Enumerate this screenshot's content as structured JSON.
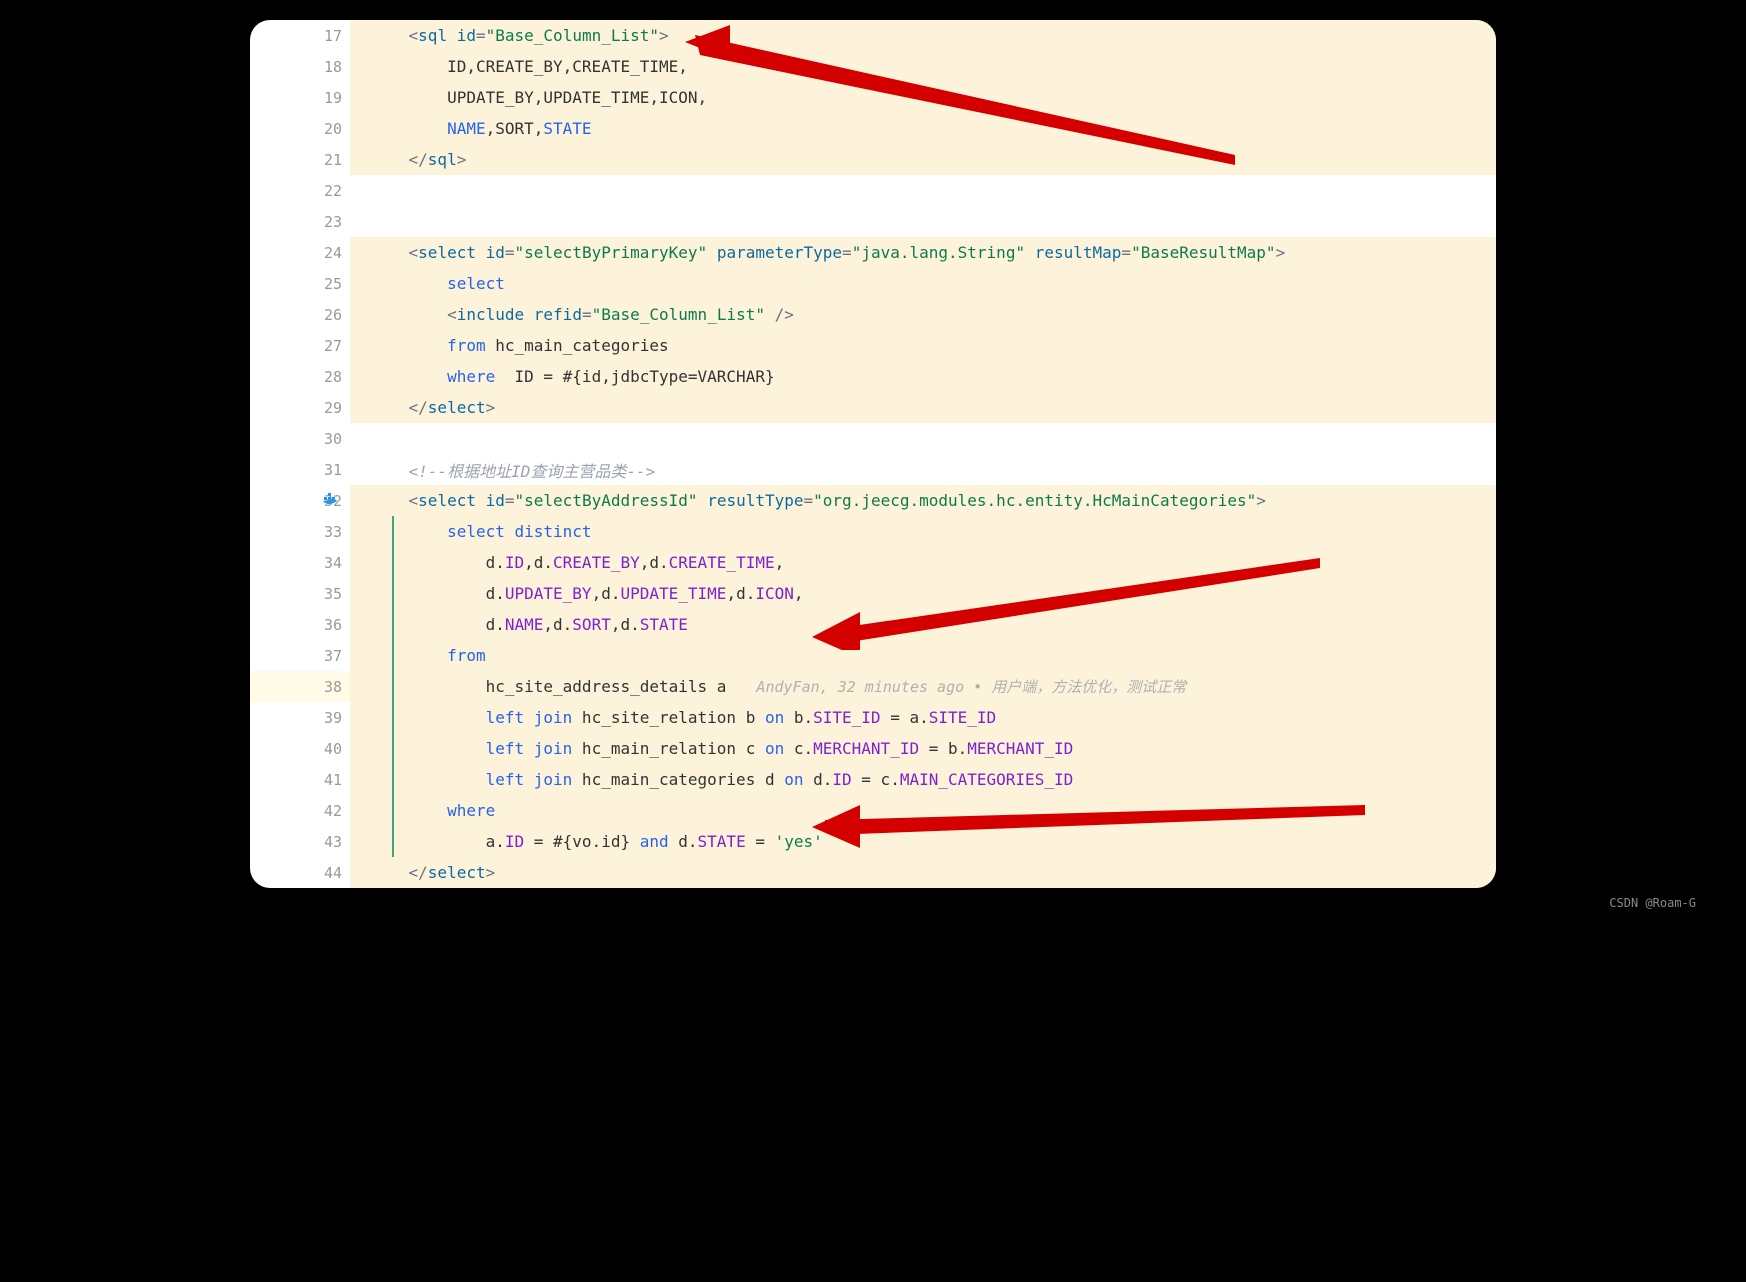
{
  "watermark": "CSDN @Roam-G",
  "annotation": {
    "author": "AndyFan,",
    "time": "32 minutes ago",
    "sep": "•",
    "message": "用户端，方法优化，测试正常"
  },
  "lines": [
    {
      "num": "17",
      "indent": 1,
      "bg": "hl",
      "tokens": [
        {
          "c": "punct",
          "t": "<"
        },
        {
          "c": "tag",
          "t": "sql"
        },
        {
          "c": "txt",
          "t": " "
        },
        {
          "c": "attr",
          "t": "id"
        },
        {
          "c": "punct",
          "t": "="
        },
        {
          "c": "str",
          "t": "\"Base_Column_List\""
        },
        {
          "c": "punct",
          "t": ">"
        }
      ]
    },
    {
      "num": "18",
      "indent": 2,
      "bg": "hl",
      "tokens": [
        {
          "c": "txt",
          "t": "ID,CREATE_BY,CREATE_TIME,"
        }
      ]
    },
    {
      "num": "19",
      "indent": 2,
      "bg": "hl",
      "tokens": [
        {
          "c": "txt",
          "t": "UPDATE_BY,UPDATE_TIME,ICON,"
        }
      ]
    },
    {
      "num": "20",
      "indent": 2,
      "bg": "hl",
      "tokens": [
        {
          "c": "kw",
          "t": "NAME"
        },
        {
          "c": "txt",
          "t": ",SORT,"
        },
        {
          "c": "kw",
          "t": "STATE"
        }
      ]
    },
    {
      "num": "21",
      "indent": 1,
      "bg": "hl",
      "tokens": [
        {
          "c": "punct",
          "t": "</"
        },
        {
          "c": "tag",
          "t": "sql"
        },
        {
          "c": "punct",
          "t": ">"
        }
      ]
    },
    {
      "num": "22",
      "indent": 0,
      "bg": "",
      "tokens": []
    },
    {
      "num": "23",
      "indent": 0,
      "bg": "",
      "tokens": []
    },
    {
      "num": "24",
      "indent": 1,
      "bg": "hl",
      "tokens": [
        {
          "c": "punct",
          "t": "<"
        },
        {
          "c": "tag",
          "t": "select"
        },
        {
          "c": "txt",
          "t": " "
        },
        {
          "c": "attr",
          "t": "id"
        },
        {
          "c": "punct",
          "t": "="
        },
        {
          "c": "str",
          "t": "\"selectByPrimaryKey\""
        },
        {
          "c": "txt",
          "t": " "
        },
        {
          "c": "attr",
          "t": "parameterType"
        },
        {
          "c": "punct",
          "t": "="
        },
        {
          "c": "str",
          "t": "\"java.lang.String\""
        },
        {
          "c": "txt",
          "t": " "
        },
        {
          "c": "attr",
          "t": "resultMap"
        },
        {
          "c": "punct",
          "t": "="
        },
        {
          "c": "str",
          "t": "\"BaseResultMap\""
        },
        {
          "c": "punct",
          "t": ">"
        }
      ]
    },
    {
      "num": "25",
      "indent": 2,
      "bg": "hl",
      "tokens": [
        {
          "c": "kw",
          "t": "select"
        }
      ]
    },
    {
      "num": "26",
      "indent": 2,
      "bg": "hl",
      "tokens": [
        {
          "c": "punct",
          "t": "<"
        },
        {
          "c": "tag",
          "t": "include"
        },
        {
          "c": "txt",
          "t": " "
        },
        {
          "c": "attr",
          "t": "refid"
        },
        {
          "c": "punct",
          "t": "="
        },
        {
          "c": "str",
          "t": "\"Base_Column_List\""
        },
        {
          "c": "txt",
          "t": " "
        },
        {
          "c": "punct",
          "t": "/>"
        }
      ]
    },
    {
      "num": "27",
      "indent": 2,
      "bg": "hl",
      "tokens": [
        {
          "c": "kw",
          "t": "from"
        },
        {
          "c": "txt",
          "t": " hc_main_categories"
        }
      ]
    },
    {
      "num": "28",
      "indent": 2,
      "bg": "hl",
      "tokens": [
        {
          "c": "kw",
          "t": "where"
        },
        {
          "c": "txt",
          "t": "  ID = #{id,jdbcType=VARCHAR}"
        }
      ]
    },
    {
      "num": "29",
      "indent": 1,
      "bg": "hl",
      "tokens": [
        {
          "c": "punct",
          "t": "</"
        },
        {
          "c": "tag",
          "t": "select"
        },
        {
          "c": "punct",
          "t": ">"
        }
      ]
    },
    {
      "num": "30",
      "indent": 0,
      "bg": "",
      "tokens": []
    },
    {
      "num": "31",
      "indent": 1,
      "bg": "",
      "tokens": [
        {
          "c": "comment",
          "t": "<!--根据地址ID查询主营品类-->"
        }
      ]
    },
    {
      "num": "32",
      "indent": 1,
      "bg": "hl",
      "icon": "docker",
      "tokens": [
        {
          "c": "punct",
          "t": "<"
        },
        {
          "c": "tag",
          "t": "select"
        },
        {
          "c": "txt",
          "t": " "
        },
        {
          "c": "attr",
          "t": "id"
        },
        {
          "c": "punct",
          "t": "="
        },
        {
          "c": "str",
          "t": "\"selectByAddressId\""
        },
        {
          "c": "txt",
          "t": " "
        },
        {
          "c": "attr",
          "t": "resultType"
        },
        {
          "c": "punct",
          "t": "="
        },
        {
          "c": "str",
          "t": "\"org.jeecg.modules.hc.entity.HcMainCategories\""
        },
        {
          "c": "punct",
          "t": ">"
        }
      ]
    },
    {
      "num": "33",
      "indent": 2,
      "bg": "hl",
      "guide": true,
      "tokens": [
        {
          "c": "kw",
          "t": "select"
        },
        {
          "c": "txt",
          "t": " "
        },
        {
          "c": "kw",
          "t": "distinct"
        }
      ]
    },
    {
      "num": "34",
      "indent": 3,
      "bg": "hl",
      "guide": true,
      "tokens": [
        {
          "c": "txt",
          "t": "d."
        },
        {
          "c": "col",
          "t": "ID"
        },
        {
          "c": "txt",
          "t": ",d."
        },
        {
          "c": "col",
          "t": "CREATE_BY"
        },
        {
          "c": "txt",
          "t": ",d."
        },
        {
          "c": "col",
          "t": "CREATE_TIME"
        },
        {
          "c": "txt",
          "t": ","
        }
      ]
    },
    {
      "num": "35",
      "indent": 3,
      "bg": "hl",
      "guide": true,
      "tokens": [
        {
          "c": "txt",
          "t": "d."
        },
        {
          "c": "col",
          "t": "UPDATE_BY"
        },
        {
          "c": "txt",
          "t": ",d."
        },
        {
          "c": "col",
          "t": "UPDATE_TIME"
        },
        {
          "c": "txt",
          "t": ",d."
        },
        {
          "c": "col",
          "t": "ICON"
        },
        {
          "c": "txt",
          "t": ","
        }
      ]
    },
    {
      "num": "36",
      "indent": 3,
      "bg": "hl",
      "guide": true,
      "tokens": [
        {
          "c": "txt",
          "t": "d."
        },
        {
          "c": "col",
          "t": "NAME"
        },
        {
          "c": "txt",
          "t": ",d."
        },
        {
          "c": "col",
          "t": "SORT"
        },
        {
          "c": "txt",
          "t": ",d."
        },
        {
          "c": "col",
          "t": "STATE"
        }
      ]
    },
    {
      "num": "37",
      "indent": 2,
      "bg": "hl",
      "guide": true,
      "tokens": [
        {
          "c": "kw",
          "t": "from"
        }
      ]
    },
    {
      "num": "38",
      "indent": 3,
      "bg": "hl",
      "guide": true,
      "icon": "bulb",
      "row": "current",
      "annot": true,
      "tokens": [
        {
          "c": "txt",
          "t": "hc_site_address_details a"
        }
      ]
    },
    {
      "num": "39",
      "indent": 3,
      "bg": "hl",
      "guide": true,
      "tokens": [
        {
          "c": "kw",
          "t": "left"
        },
        {
          "c": "txt",
          "t": " "
        },
        {
          "c": "kw",
          "t": "join"
        },
        {
          "c": "txt",
          "t": " hc_site_relation b "
        },
        {
          "c": "kw",
          "t": "on"
        },
        {
          "c": "txt",
          "t": " b."
        },
        {
          "c": "col",
          "t": "SITE_ID"
        },
        {
          "c": "txt",
          "t": " = a."
        },
        {
          "c": "col",
          "t": "SITE_ID"
        }
      ]
    },
    {
      "num": "40",
      "indent": 3,
      "bg": "hl",
      "guide": true,
      "tokens": [
        {
          "c": "kw",
          "t": "left"
        },
        {
          "c": "txt",
          "t": " "
        },
        {
          "c": "kw",
          "t": "join"
        },
        {
          "c": "txt",
          "t": " hc_main_relation c "
        },
        {
          "c": "kw",
          "t": "on"
        },
        {
          "c": "txt",
          "t": " c."
        },
        {
          "c": "col",
          "t": "MERCHANT_ID"
        },
        {
          "c": "txt",
          "t": " = b."
        },
        {
          "c": "col",
          "t": "MERCHANT_ID"
        }
      ]
    },
    {
      "num": "41",
      "indent": 3,
      "bg": "hl",
      "guide": true,
      "tokens": [
        {
          "c": "kw",
          "t": "left"
        },
        {
          "c": "txt",
          "t": " "
        },
        {
          "c": "kw",
          "t": "join"
        },
        {
          "c": "txt",
          "t": " hc_main_categories d "
        },
        {
          "c": "kw",
          "t": "on"
        },
        {
          "c": "txt",
          "t": " d."
        },
        {
          "c": "col",
          "t": "ID"
        },
        {
          "c": "txt",
          "t": " = c."
        },
        {
          "c": "col",
          "t": "MAIN_CATEGORIES_ID"
        }
      ]
    },
    {
      "num": "42",
      "indent": 2,
      "bg": "hl",
      "guide": true,
      "tokens": [
        {
          "c": "kw",
          "t": "where"
        }
      ]
    },
    {
      "num": "43",
      "indent": 3,
      "bg": "hl",
      "guide": true,
      "tokens": [
        {
          "c": "txt",
          "t": "a."
        },
        {
          "c": "col",
          "t": "ID"
        },
        {
          "c": "txt",
          "t": " = #{vo.id} "
        },
        {
          "c": "kw",
          "t": "and"
        },
        {
          "c": "txt",
          "t": " d."
        },
        {
          "c": "col",
          "t": "STATE"
        },
        {
          "c": "txt",
          "t": " = "
        },
        {
          "c": "strlit",
          "t": "'yes'"
        }
      ]
    },
    {
      "num": "44",
      "indent": 1,
      "bg": "hl",
      "tokens": [
        {
          "c": "punct",
          "t": "</"
        },
        {
          "c": "tag",
          "t": "select"
        },
        {
          "c": "punct",
          "t": ">"
        }
      ]
    }
  ]
}
